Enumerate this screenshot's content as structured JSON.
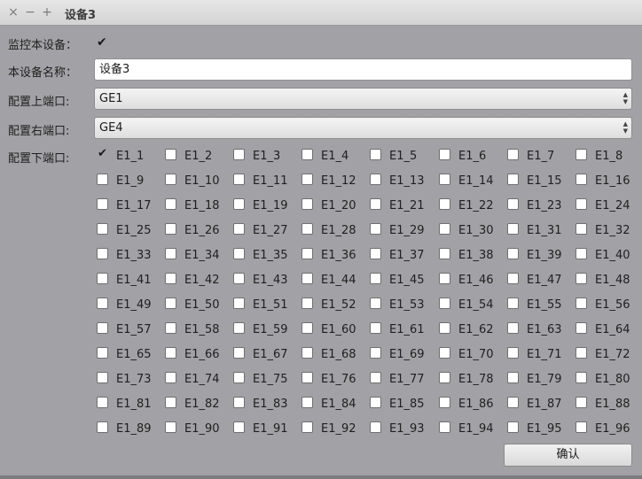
{
  "window": {
    "title": "设备3",
    "close_glyph": "×",
    "minimize_glyph": "−",
    "maximize_glyph": "+"
  },
  "form": {
    "monitor_label": "监控本设备：",
    "monitor_checked": true,
    "name_label": "本设备名称：",
    "name_value": "设备3",
    "upper_port_label": "配置上端口:",
    "upper_port_value": "GE1",
    "right_port_label": "配置右端口:",
    "right_port_value": "GE4",
    "lower_port_label": "配置下端口:"
  },
  "ports": {
    "checked": [
      "E1_1"
    ],
    "labels": [
      "E1_1",
      "E1_2",
      "E1_3",
      "E1_4",
      "E1_5",
      "E1_6",
      "E1_7",
      "E1_8",
      "E1_9",
      "E1_10",
      "E1_11",
      "E1_12",
      "E1_13",
      "E1_14",
      "E1_15",
      "E1_16",
      "E1_17",
      "E1_18",
      "E1_19",
      "E1_20",
      "E1_21",
      "E1_22",
      "E1_23",
      "E1_24",
      "E1_25",
      "E1_26",
      "E1_27",
      "E1_28",
      "E1_29",
      "E1_30",
      "E1_31",
      "E1_32",
      "E1_33",
      "E1_34",
      "E1_35",
      "E1_36",
      "E1_37",
      "E1_38",
      "E1_39",
      "E1_40",
      "E1_41",
      "E1_42",
      "E1_43",
      "E1_44",
      "E1_45",
      "E1_46",
      "E1_47",
      "E1_48",
      "E1_49",
      "E1_50",
      "E1_51",
      "E1_52",
      "E1_53",
      "E1_54",
      "E1_55",
      "E1_56",
      "E1_57",
      "E1_58",
      "E1_59",
      "E1_60",
      "E1_61",
      "E1_62",
      "E1_63",
      "E1_64",
      "E1_65",
      "E1_66",
      "E1_67",
      "E1_68",
      "E1_69",
      "E1_70",
      "E1_71",
      "E1_72",
      "E1_73",
      "E1_74",
      "E1_75",
      "E1_76",
      "E1_77",
      "E1_78",
      "E1_79",
      "E1_80",
      "E1_81",
      "E1_82",
      "E1_83",
      "E1_84",
      "E1_85",
      "E1_86",
      "E1_87",
      "E1_88",
      "E1_89",
      "E1_90",
      "E1_91",
      "E1_92",
      "E1_93",
      "E1_94",
      "E1_95",
      "E1_96"
    ]
  },
  "actions": {
    "confirm_label": "确认"
  }
}
